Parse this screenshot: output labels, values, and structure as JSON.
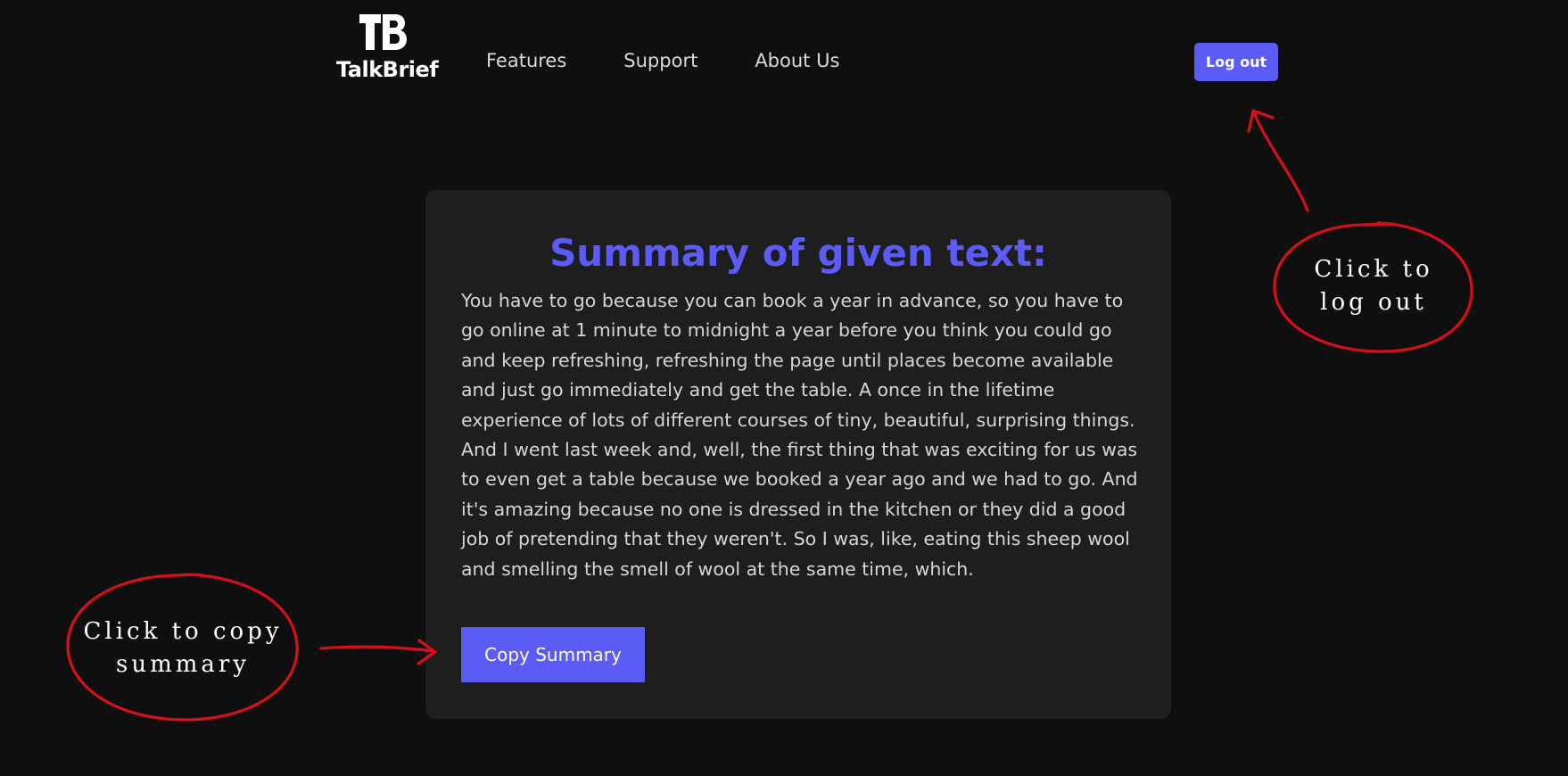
{
  "brand": {
    "logo_mark": "TB",
    "name": "TalkBrief"
  },
  "nav": {
    "items": [
      {
        "label": "Features"
      },
      {
        "label": "Support"
      },
      {
        "label": "About Us"
      }
    ]
  },
  "header": {
    "logout_label": "Log out"
  },
  "card": {
    "title": "Summary of given text:",
    "summary": "You have to go because you can book a year in advance, so you have to go online at 1 minute to midnight a year before you think you could go and keep refreshing, refreshing the page until places become available and just go immediately and get the table. A once in the lifetime experience of lots of different courses of tiny, beautiful, surprising things. And I went last week and, well, the first thing that was exciting for us was to even get a table because we booked a year ago and we had to go. And it's amazing because no one is dressed in the kitchen or they did a good job of pretending that they weren't. So I was, like, eating this sheep wool and smelling the smell of wool at the same time, which.",
    "copy_label": "Copy Summary"
  },
  "annotations": {
    "logout_line1": "Click to",
    "logout_line2": "log out",
    "copy_line1": "Click to copy",
    "copy_line2": "summary"
  },
  "colors": {
    "background": "#0f0f10",
    "card": "#1e1e1f",
    "accent": "#5b5bf5",
    "annotation": "#d4101a"
  }
}
